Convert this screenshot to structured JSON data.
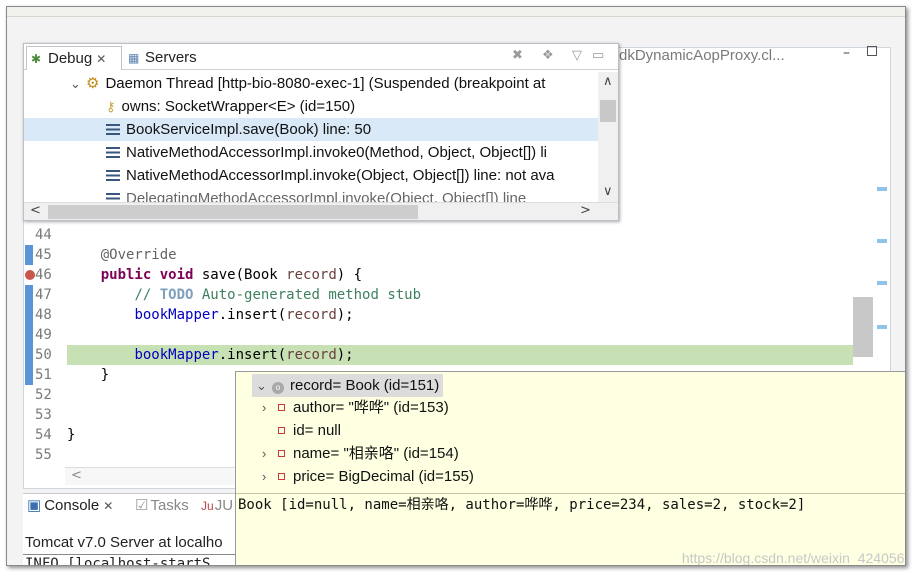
{
  "background_tab": {
    "label": "dkDynamicAopProxy.cl..."
  },
  "debug_view": {
    "tabs": [
      {
        "label": "Debug",
        "icon": "debug-icon",
        "active": true
      },
      {
        "label": "Servers",
        "icon": "servers-icon",
        "active": false
      }
    ],
    "rows": [
      {
        "text": "Daemon Thread [http-bio-8080-exec-1] (Suspended (breakpoint at",
        "icon": "thread-icon",
        "expanded": true
      },
      {
        "text": "owns: SocketWrapper<E>  (id=150)",
        "icon": "key-icon"
      },
      {
        "text": "BookServiceImpl.save(Book) line: 50",
        "icon": "stack-frame-icon",
        "selected": true
      },
      {
        "text": "NativeMethodAccessorImpl.invoke0(Method, Object, Object[]) li",
        "icon": "stack-frame-icon"
      },
      {
        "text": "NativeMethodAccessorImpl.invoke(Object, Object[]) line: not ava",
        "icon": "stack-frame-icon"
      },
      {
        "text": "DelegatingMethodAccessorImpl.invoke(Object, Object[]) line",
        "icon": "stack-frame-icon"
      }
    ]
  },
  "editor": {
    "lines": [
      {
        "num": "44",
        "html": ""
      },
      {
        "num": "45",
        "parts": [
          {
            "t": "    "
          },
          {
            "t": "@Override",
            "c": "ann"
          }
        ]
      },
      {
        "num": "46",
        "parts": [
          {
            "t": "    "
          },
          {
            "t": "public",
            "c": "kw"
          },
          {
            "t": " "
          },
          {
            "t": "void",
            "c": "kw"
          },
          {
            "t": " save(Book "
          },
          {
            "t": "record",
            "c": "var"
          },
          {
            "t": ") {"
          }
        ]
      },
      {
        "num": "47",
        "parts": [
          {
            "t": "        "
          },
          {
            "t": "// ",
            "c": "cm"
          },
          {
            "t": "TODO",
            "c": "tdo"
          },
          {
            "t": " Auto-generated method stub",
            "c": "cm"
          }
        ]
      },
      {
        "num": "48",
        "parts": [
          {
            "t": "        "
          },
          {
            "t": "bookMapper",
            "c": "fld"
          },
          {
            "t": ".insert("
          },
          {
            "t": "record",
            "c": "var"
          },
          {
            "t": ");"
          }
        ]
      },
      {
        "num": "49",
        "parts": []
      },
      {
        "num": "50",
        "parts": [
          {
            "t": "        "
          },
          {
            "t": "bookMapper",
            "c": "fld"
          },
          {
            "t": ".insert("
          },
          {
            "t": "record",
            "c": "var"
          },
          {
            "t": ");"
          }
        ],
        "highlight": true
      },
      {
        "num": "51",
        "parts": [
          {
            "t": "    }"
          }
        ]
      },
      {
        "num": "52",
        "parts": []
      },
      {
        "num": "53",
        "parts": []
      },
      {
        "num": "54",
        "parts": [
          {
            "t": "}"
          }
        ]
      },
      {
        "num": "55",
        "parts": []
      }
    ]
  },
  "console": {
    "tabs": [
      {
        "label": "Console",
        "icon": "console-icon"
      },
      {
        "label": "Tasks",
        "icon": "tasks-icon"
      },
      {
        "label": "JU",
        "icon": "junit-icon"
      }
    ],
    "server_line": "Tomcat v7.0 Server at localho",
    "log_line": " INFO [localhost-startS"
  },
  "hover": {
    "root": "record= Book  (id=151)",
    "children": [
      {
        "text": "author= \"哗哗\" (id=153)",
        "expandable": true
      },
      {
        "text": "id= null",
        "expandable": false
      },
      {
        "text": "name= \"相亲咯\" (id=154)",
        "expandable": true
      },
      {
        "text": "price= BigDecimal  (id=155)",
        "expandable": true
      }
    ],
    "tostring": "Book [id=null, name=相亲咯, author=哗哗, price=234, sales=2, stock=2]"
  },
  "watermark": "https://blog.csdn.net/weixin_42405670"
}
